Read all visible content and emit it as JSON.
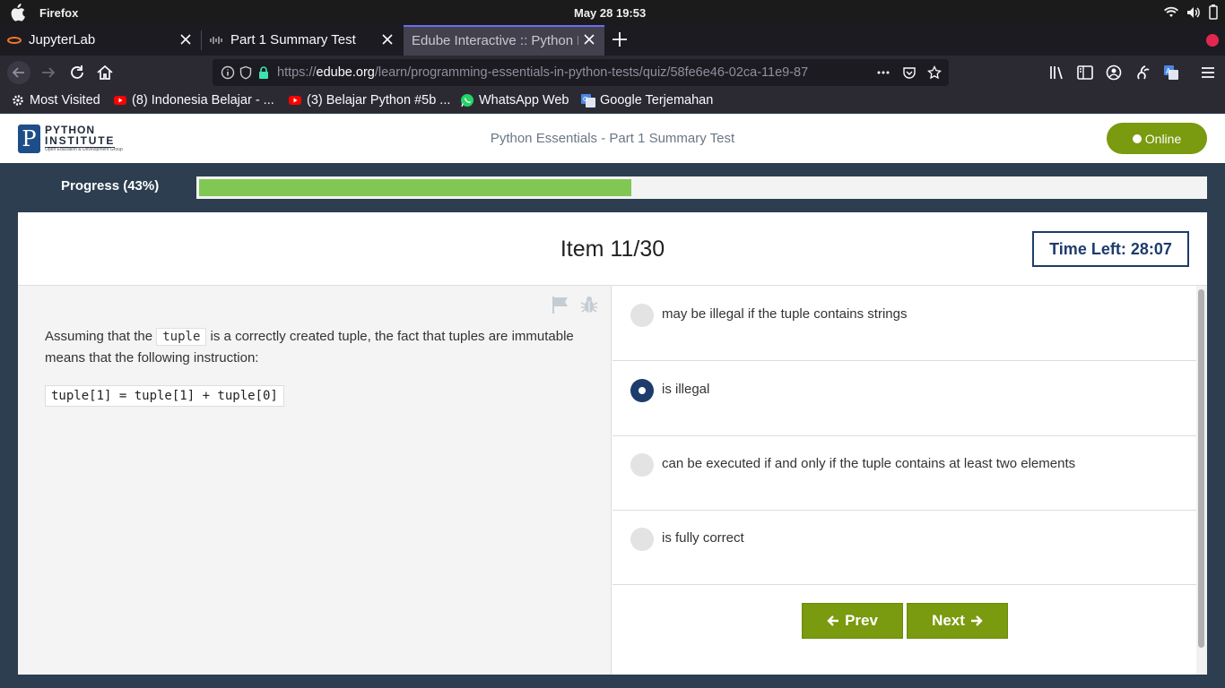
{
  "os": {
    "app_name": "Firefox",
    "clock": "May 28  19:53"
  },
  "tabs": [
    {
      "title": "JupyterLab",
      "icon": "jupyter-icon"
    },
    {
      "title": "Part 1 Summary Test",
      "icon": "cisco-icon"
    },
    {
      "title": "Edube Interactive :: Python E",
      "icon": "none",
      "active": true
    }
  ],
  "urlbar": {
    "prefix": "https://",
    "domain": "edube.org",
    "path": "/learn/programming-essentials-in-python-tests/quiz/58fe6e46-02ca-11e9-87"
  },
  "bookmarks": [
    {
      "label": "Most Visited",
      "icon": "gear-icon"
    },
    {
      "label": "(8) Indonesia Belajar - ...",
      "icon": "youtube-icon"
    },
    {
      "label": "(3) Belajar Python #5b ...",
      "icon": "youtube-icon"
    },
    {
      "label": "WhatsApp Web",
      "icon": "whatsapp-icon"
    },
    {
      "label": "Google Terjemahan",
      "icon": "google-translate-icon"
    }
  ],
  "site": {
    "logo_line1": "PYTHON",
    "logo_line2": "INSTITUTE",
    "logo_line3": "Open Education & Development Group",
    "title": "Python Essentials - Part 1 Summary Test",
    "online_label": "Online"
  },
  "progress": {
    "label": "Progress (43%)",
    "percent": 43
  },
  "quiz": {
    "item_label": "Item 11/30",
    "time_left": "Time Left: 28:07",
    "question_before": "Assuming that the ",
    "question_code": "tuple",
    "question_after": " is a correctly created tuple, the fact that tuples are immutable means that the following instruction:",
    "code_block": "tuple[1] = tuple[1] + tuple[0]",
    "answers": [
      {
        "text": "may be illegal if the tuple contains strings",
        "selected": false
      },
      {
        "text": "is illegal",
        "selected": true
      },
      {
        "text": "can be executed if and only if the tuple contains at least two elements",
        "selected": false
      },
      {
        "text": "is fully correct",
        "selected": false
      }
    ],
    "prev_label": "Prev",
    "next_label": "Next"
  },
  "colors": {
    "accent_green": "#7a9a0f",
    "progress_green": "#80c853",
    "navy": "#1d3c6b",
    "page_bg": "#2c3e50"
  }
}
